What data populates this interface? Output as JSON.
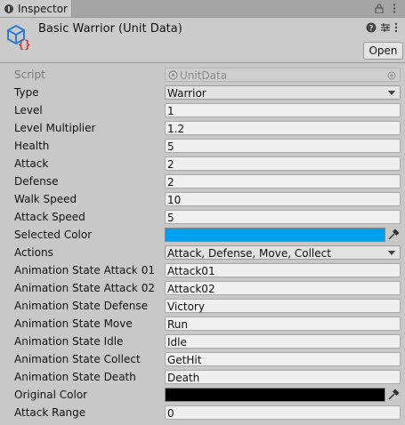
{
  "tab": {
    "label": "Inspector",
    "icon": "info-icon"
  },
  "toolbar_icons": [
    "lock-icon",
    "kebab-menu-icon"
  ],
  "header": {
    "title": "Basic Warrior (Unit Data)",
    "icon": "scriptable-object-icon",
    "open_label": "Open",
    "icons": [
      "help-icon",
      "preset-icon",
      "kebab-menu-icon"
    ]
  },
  "colors": {
    "selected_color": "#00a2f0",
    "original_color": "#000000",
    "accent_blue": "#2a7fd4",
    "brace_red": "#d0312d"
  },
  "properties": {
    "script": {
      "label": "Script",
      "value": "UnitData"
    },
    "type": {
      "label": "Type",
      "value": "Warrior"
    },
    "level": {
      "label": "Level",
      "value": "1"
    },
    "level_multiplier": {
      "label": "Level Multiplier",
      "value": "1.2"
    },
    "health": {
      "label": "Health",
      "value": "5"
    },
    "attack": {
      "label": "Attack",
      "value": "2"
    },
    "defense": {
      "label": "Defense",
      "value": "2"
    },
    "walk_speed": {
      "label": "Walk Speed",
      "value": "10"
    },
    "attack_speed": {
      "label": "Attack Speed",
      "value": "5"
    },
    "selected_color": {
      "label": "Selected Color"
    },
    "actions": {
      "label": "Actions",
      "value": "Attack, Defense, Move, Collect"
    },
    "anim_attack01": {
      "label": "Animation State Attack 01",
      "value": "Attack01"
    },
    "anim_attack02": {
      "label": "Animation State Attack 02",
      "value": "Attack02"
    },
    "anim_defense": {
      "label": "Animation State Defense",
      "value": "Victory"
    },
    "anim_move": {
      "label": "Animation State Move",
      "value": "Run"
    },
    "anim_idle": {
      "label": "Animation State Idle",
      "value": "Idle"
    },
    "anim_collect": {
      "label": "Animation State Collect",
      "value": "GetHit"
    },
    "anim_death": {
      "label": "Animation State Death",
      "value": "Death"
    },
    "original_color": {
      "label": "Original Color"
    },
    "attack_range": {
      "label": "Attack Range",
      "value": "0"
    }
  }
}
